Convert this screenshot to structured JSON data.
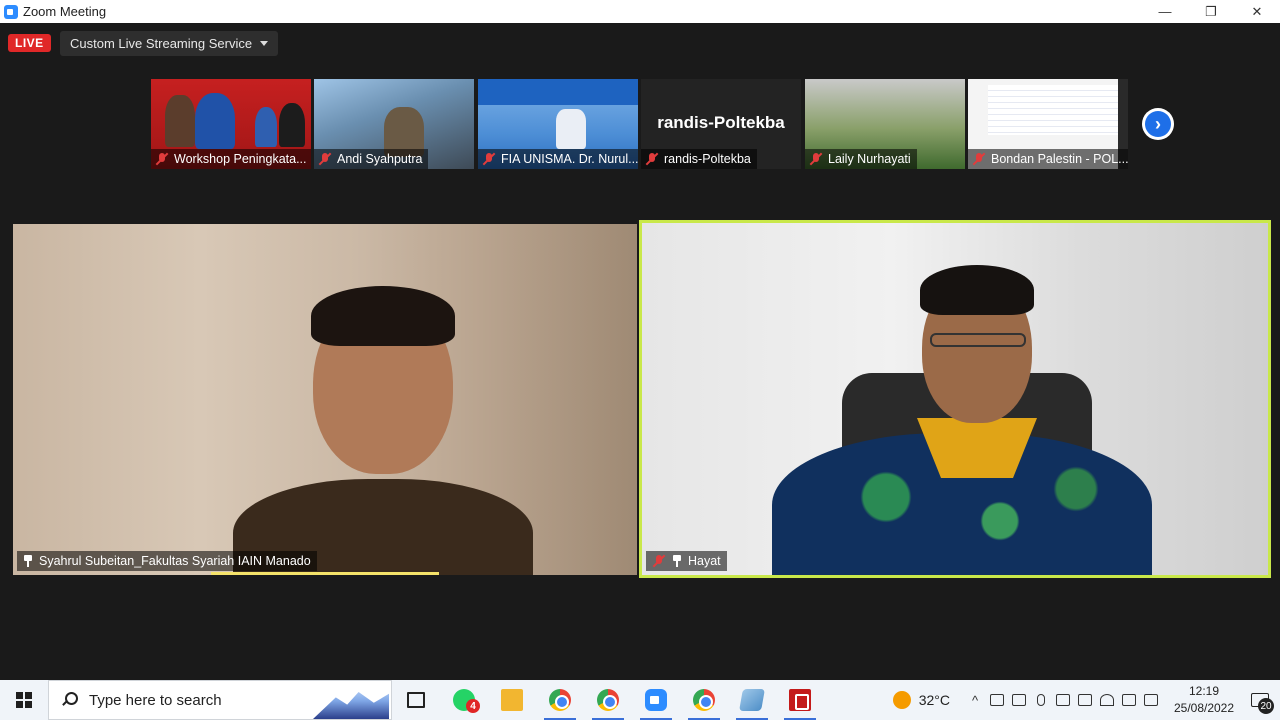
{
  "window": {
    "title": "Zoom Meeting",
    "controls": {
      "minimize": "—",
      "restore": "❐",
      "close": "✕"
    }
  },
  "meeting": {
    "live_label": "LIVE",
    "streaming_service": "Custom Live Streaming Service",
    "thumbnails": [
      {
        "name": "Workshop Peningkata...",
        "muted": true
      },
      {
        "name": "Andi Syahputra",
        "muted": true
      },
      {
        "name": "FIA UNISMA. Dr. Nurul...",
        "muted": true
      },
      {
        "name": "randis-Poltekba",
        "muted": true,
        "display_text": "randis-Poltekba"
      },
      {
        "name": "Laily Nurhayati",
        "muted": true
      },
      {
        "name": "Bondan Palestin - POL...",
        "muted": true
      }
    ],
    "next_button_label": "›",
    "main_videos": [
      {
        "name": "Syahrul Subeitan_Fakultas Syariah IAIN Manado",
        "pinned": true,
        "muted": false
      },
      {
        "name": "Hayat",
        "pinned": true,
        "muted": true,
        "active_speaker": true
      }
    ]
  },
  "taskbar": {
    "search_placeholder": "Type here to search",
    "whatsapp_badge": "4",
    "weather_temp": "32°C",
    "time": "12:19",
    "date": "25/08/2022",
    "notification_count": "20",
    "tray_chevron": "^"
  },
  "colors": {
    "live_red": "#e02828",
    "active_speaker_border": "#c9e84a",
    "zoom_blue": "#2d8cff",
    "next_button_blue": "#1e6fe8"
  }
}
